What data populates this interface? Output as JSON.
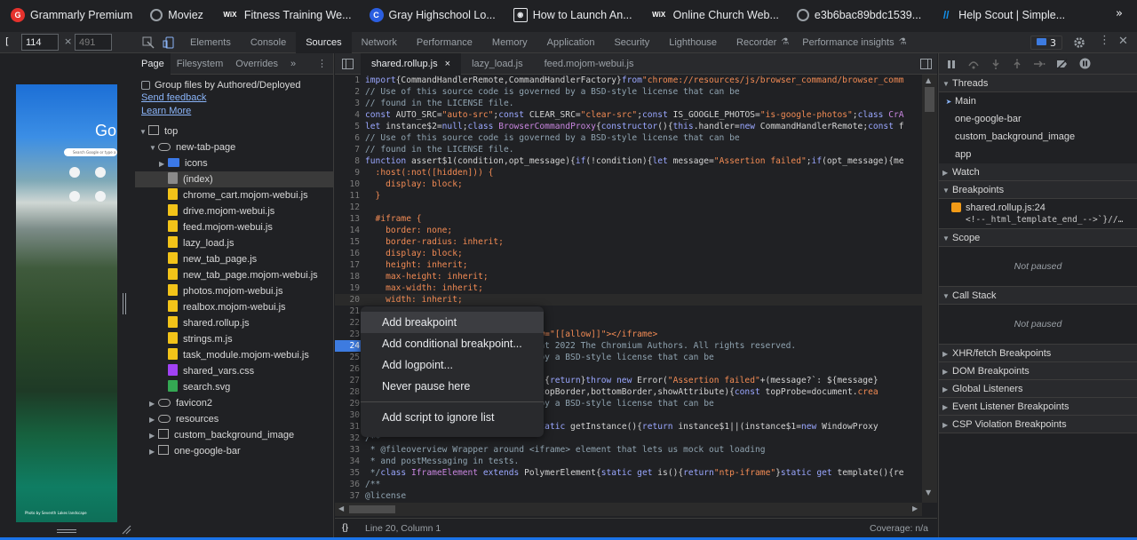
{
  "bookmarks": {
    "items": [
      {
        "label": "Grammarly Premium",
        "icon": "grammarly-icon",
        "color": "#e5322d",
        "glyph": "G"
      },
      {
        "label": "Moviez",
        "icon": "globe-icon",
        "color": "#9aa0a6",
        "glyph": ""
      },
      {
        "label": "Fitness Training We...",
        "icon": "wix-icon",
        "color": "#ffffff",
        "glyph": "WiX"
      },
      {
        "label": "Gray Highschool Lo...",
        "icon": "gray-logo-icon",
        "color": "#2b5ee0",
        "glyph": "C"
      },
      {
        "label": "How to Launch An...",
        "icon": "page-icon",
        "color": "#e8eaed",
        "glyph": "◉"
      },
      {
        "label": "Online Church Web...",
        "icon": "wix-icon",
        "color": "#ffffff",
        "glyph": "WiX"
      },
      {
        "label": "e3b6bac89bdc1539...",
        "icon": "globe-icon",
        "color": "#9aa0a6",
        "glyph": ""
      },
      {
        "label": "Help Scout | Simple...",
        "icon": "helpscout-icon",
        "color": "#1292ee",
        "glyph": "//"
      }
    ],
    "more": "»"
  },
  "device": {
    "width": "114",
    "height": "491",
    "separator": "×"
  },
  "preview": {
    "logo_fragment": "Go",
    "search_placeholder": "Search Google or type a URL",
    "caption": "Photo by Seventh Lakes landscape"
  },
  "devtools_tabs": [
    "Elements",
    "Console",
    "Sources",
    "Network",
    "Performance",
    "Memory",
    "Application",
    "Security",
    "Lighthouse",
    "Recorder",
    "Performance insights"
  ],
  "issues_count": "3",
  "navigator": {
    "tabs": [
      "Page",
      "Filesystem",
      "Overrides"
    ],
    "group_label": "Group files by Authored/Deployed",
    "send_feedback": "Send feedback",
    "learn_more": "Learn More",
    "tree": [
      {
        "label": "top",
        "indent": 0,
        "icon": "frame-icon",
        "arrow": "▼"
      },
      {
        "label": "new-tab-page",
        "indent": 1,
        "icon": "cloud-icon",
        "arrow": "▼"
      },
      {
        "label": "icons",
        "indent": 2,
        "icon": "folder-icon",
        "arrow": "▶"
      },
      {
        "label": "(index)",
        "indent": 2,
        "icon": "file-gray-icon",
        "arrow": ""
      },
      {
        "label": "chrome_cart.mojom-webui.js",
        "indent": 2,
        "icon": "file-js-icon",
        "arrow": ""
      },
      {
        "label": "drive.mojom-webui.js",
        "indent": 2,
        "icon": "file-js-icon",
        "arrow": ""
      },
      {
        "label": "feed.mojom-webui.js",
        "indent": 2,
        "icon": "file-js-icon",
        "arrow": ""
      },
      {
        "label": "lazy_load.js",
        "indent": 2,
        "icon": "file-js-icon",
        "arrow": ""
      },
      {
        "label": "new_tab_page.js",
        "indent": 2,
        "icon": "file-js-icon",
        "arrow": ""
      },
      {
        "label": "new_tab_page.mojom-webui.js",
        "indent": 2,
        "icon": "file-js-icon",
        "arrow": ""
      },
      {
        "label": "photos.mojom-webui.js",
        "indent": 2,
        "icon": "file-js-icon",
        "arrow": ""
      },
      {
        "label": "realbox.mojom-webui.js",
        "indent": 2,
        "icon": "file-js-icon",
        "arrow": ""
      },
      {
        "label": "shared.rollup.js",
        "indent": 2,
        "icon": "file-js-icon",
        "arrow": ""
      },
      {
        "label": "strings.m.js",
        "indent": 2,
        "icon": "file-js-icon",
        "arrow": ""
      },
      {
        "label": "task_module.mojom-webui.js",
        "indent": 2,
        "icon": "file-js-icon",
        "arrow": ""
      },
      {
        "label": "shared_vars.css",
        "indent": 2,
        "icon": "file-css-icon",
        "arrow": ""
      },
      {
        "label": "search.svg",
        "indent": 2,
        "icon": "file-svg-icon",
        "arrow": ""
      },
      {
        "label": "favicon2",
        "indent": 1,
        "icon": "cloud-icon",
        "arrow": "▶"
      },
      {
        "label": "resources",
        "indent": 1,
        "icon": "cloud-icon",
        "arrow": "▶"
      },
      {
        "label": "custom_background_image",
        "indent": 1,
        "icon": "frame-icon",
        "arrow": "▶"
      },
      {
        "label": "one-google-bar",
        "indent": 1,
        "icon": "frame-icon",
        "arrow": "▶"
      }
    ]
  },
  "editor": {
    "tabs": [
      {
        "label": "shared.rollup.js",
        "close": "×"
      },
      {
        "label": "lazy_load.js"
      },
      {
        "label": "feed.mojom-webui.js"
      }
    ],
    "lines": [
      {
        "n": "1",
        "html": "<span class=ck>import</span>{CommandHandlerRemote,CommandHandlerFactory}<span class=ck>from</span><span class=cs>\"chrome://resources/js/browser_command/browser_comm</span>"
      },
      {
        "n": "2",
        "html": "<span class=cc>// Use of this source code is governed by a BSD-style license that can be</span>"
      },
      {
        "n": "3",
        "html": "<span class=cc>// found in the LICENSE file.</span>"
      },
      {
        "n": "4",
        "html": "<span class=ck>const</span> AUTO_SRC=<span class=cs>\"auto-src\"</span>;<span class=ck>const</span> CLEAR_SRC=<span class=cs>\"clear-src\"</span>;<span class=ck>const</span> IS_GOOGLE_PHOTOS=<span class=cs>\"is-google-photos\"</span>;<span class=ck>class</span> <span class=cp>CrA</span>"
      },
      {
        "n": "5",
        "html": "<span class=ck>let</span> instance$2=<span class=ck>null</span>;<span class=ck>class</span> <span class=cp>BrowserCommandProxy</span>{<span class=ck>constructor</span>(){<span class=ck>this</span>.handler=<span class=ck>new</span> CommandHandlerRemote;<span class=ck>const</span> f"
      },
      {
        "n": "6",
        "html": "<span class=cc>// Use of this source code is governed by a BSD-style license that can be</span>"
      },
      {
        "n": "7",
        "html": "<span class=cc>// found in the LICENSE file.</span>"
      },
      {
        "n": "8",
        "html": "<span class=ck>function</span> assert$1(condition,opt_message){<span class=ck>if</span>(!condition){<span class=ck>let</span> message=<span class=cs>\"Assertion failed\"</span>;<span class=ck>if</span>(opt_message){me"
      },
      {
        "n": "9",
        "html": "<span class=cs>  :host(:not([hidden])) {</span>"
      },
      {
        "n": "10",
        "html": "<span class=cs>    display: block;</span>"
      },
      {
        "n": "11",
        "html": "<span class=cs>  }</span>"
      },
      {
        "n": "12",
        "html": ""
      },
      {
        "n": "13",
        "html": "<span class=cs>  #iframe {</span>"
      },
      {
        "n": "14",
        "html": "<span class=cs>    border: none;</span>"
      },
      {
        "n": "15",
        "html": "<span class=cs>    border-radius: inherit;</span>"
      },
      {
        "n": "16",
        "html": "<span class=cs>    display: block;</span>"
      },
      {
        "n": "17",
        "html": "<span class=cs>    height: inherit;</span>"
      },
      {
        "n": "18",
        "html": "<span class=cs>    max-height: inherit;</span>"
      },
      {
        "n": "19",
        "html": "<span class=cs>    max-width: inherit;</span>"
      },
      {
        "n": "20",
        "html": "<span class=cs>    width: inherit;</span>"
      },
      {
        "n": "21",
        "html": ""
      },
      {
        "n": "22",
        "html": ""
      },
      {
        "n": "23",
        "html": "                            <span class=cs>\" allow=\"[[allow]]\"&gt;&lt;/iframe&gt;</span>"
      },
      {
        "n": "24",
        "html": "                            <span class=cc>opyright 2022 The Chromium Authors. All rights reserved.</span>"
      },
      {
        "n": "25",
        "html": "                            <span class=cc>erned by a BSD-style license that can be</span>"
      },
      {
        "n": "26",
        "html": ""
      },
      {
        "n": "27",
        "html": "                            (value){<span class=ck>return</span>}<span class=ck>throw new</span> Error(<span class=cs>\"Assertion failed\"</span>+(message?`: ${message}"
      },
      {
        "n": "28",
        "html": "                            ainer,topBorder,bottomBorder,showAttribute){<span class=ck>const</span> topProbe=document.<span class=cs>crea</span>"
      },
      {
        "n": "29",
        "html": "                            <span class=cc>erned by a BSD-style license that can be</span>"
      },
      {
        "n": "30",
        "html": ""
      },
      {
        "n": "31",
        "html": "                            <span class=cp>roxy</span>{<span class=ck>static</span> getInstance(){<span class=ck>return</span> instance$1||(instance$1=<span class=ck>new</span> WindowProxy"
      },
      {
        "n": "32",
        "html": "<span class=cc>/**</span>"
      },
      {
        "n": "33",
        "html": "<span class=cc> * @fileoverview Wrapper around &lt;iframe&gt; element that lets us mock out loading</span>"
      },
      {
        "n": "34",
        "html": "<span class=cc> * and postMessaging in tests.</span>"
      },
      {
        "n": "35",
        "html": "<span class=cc> */</span><span class=ck>class</span> <span class=cp>IframeElement</span> <span class=ck>extends</span> PolymerElement{<span class=ck>static get</span> is(){<span class=ck>return</span><span class=cs>\"ntp-iframe\"</span>}<span class=ck>static get</span> template(){re"
      },
      {
        "n": "36",
        "html": "<span class=cc>/**</span>"
      },
      {
        "n": "37",
        "html": "<span class=cc>@license</span>"
      }
    ],
    "breakpoint_line": "24",
    "current_line": "20"
  },
  "status": {
    "braces": "{}",
    "position": "Line 20, Column 1",
    "coverage": "Coverage: n/a"
  },
  "context_menu": {
    "items": [
      "Add breakpoint",
      "Add conditional breakpoint...",
      "Add logpoint...",
      "Never pause here"
    ],
    "extra": "Add script to ignore list"
  },
  "debugger": {
    "threads_label": "Threads",
    "threads": [
      "Main",
      "one-google-bar",
      "custom_background_image",
      "app"
    ],
    "watch_label": "Watch",
    "breakpoints_label": "Breakpoints",
    "breakpoint_file": "shared.rollup.js:24",
    "breakpoint_snippet": "<!--_html_template_end_-->`}//…",
    "scope_label": "Scope",
    "not_paused": "Not paused",
    "callstack_label": "Call Stack",
    "not_paused2": "Not paused",
    "sections": [
      "XHR/fetch Breakpoints",
      "DOM Breakpoints",
      "Global Listeners",
      "Event Listener Breakpoints",
      "CSP Violation Breakpoints"
    ]
  }
}
